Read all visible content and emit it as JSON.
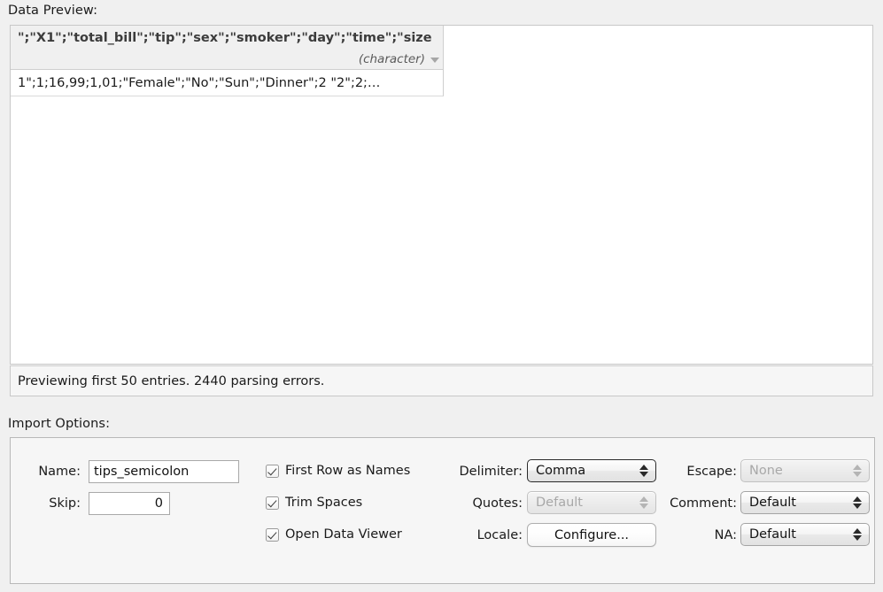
{
  "data_preview": {
    "section_label": "Data Preview:",
    "column": {
      "name": "\";\"X1\";\"total_bill\";\"tip\";\"sex\";\"smoker\";\"day\";\"time\";\"size",
      "type": "(character)",
      "type_caret_icon": "chevron-down-icon"
    },
    "rows": [
      {
        "value": "1\";1;16,99;1,01;\"Female\";\"No\";\"Sun\";\"Dinner\";2 \"2\";2;…"
      }
    ],
    "status": "Previewing first 50 entries. 2440 parsing errors."
  },
  "import_options": {
    "section_label": "Import Options:",
    "fields": {
      "name_label": "Name:",
      "name_value": "tips_semicolon",
      "skip_label": "Skip:",
      "skip_value": "0"
    },
    "checkboxes": [
      {
        "label": "First Row as Names",
        "checked": true
      },
      {
        "label": "Trim Spaces",
        "checked": true
      },
      {
        "label": "Open Data Viewer",
        "checked": true
      }
    ],
    "selects": {
      "delimiter_label": "Delimiter:",
      "delimiter_value": "Comma",
      "quotes_label": "Quotes:",
      "quotes_value": "Default",
      "locale_label": "Locale:",
      "locale_button": "Configure...",
      "escape_label": "Escape:",
      "escape_value": "None",
      "comment_label": "Comment:",
      "comment_value": "Default",
      "na_label": "NA:",
      "na_value": "Default"
    }
  },
  "colors": {
    "window_background": "#f0f0f0",
    "panel_background": "#f6f6f6",
    "grid_background": "#ffffff",
    "header_background": "#f0f0f0",
    "border": "#c8c8c8",
    "text": "#1a1a1a",
    "disabled_text": "#a8a8a8"
  }
}
